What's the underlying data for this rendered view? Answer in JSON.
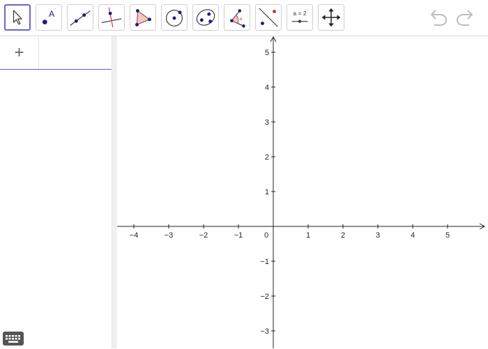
{
  "toolbar": {
    "tools": [
      {
        "icon": "move-arrow-icon",
        "active": true
      },
      {
        "icon": "point-icon",
        "label": "A"
      },
      {
        "icon": "line-icon"
      },
      {
        "icon": "perpendicular-line-icon"
      },
      {
        "icon": "polygon-icon"
      },
      {
        "icon": "circle-center-point-icon"
      },
      {
        "icon": "conic-ellipse-icon"
      },
      {
        "icon": "angle-icon",
        "label": "α"
      },
      {
        "icon": "reflect-about-line-icon"
      },
      {
        "icon": "slider-icon",
        "label": "a = 2"
      },
      {
        "icon": "move-graphics-view-icon"
      }
    ],
    "undo_icon": "undo-icon",
    "redo_icon": "redo-icon"
  },
  "algebra": {
    "add_label": "+"
  },
  "graphics": {
    "x_ticks": [
      "−4",
      "−3",
      "−2",
      "−1",
      "0",
      "1",
      "2",
      "3",
      "4",
      "5"
    ],
    "y_ticks": [
      "5",
      "4",
      "3",
      "2",
      "1",
      "−1",
      "−2",
      "−3"
    ],
    "x_range": [
      -4.5,
      6.1
    ],
    "y_range": [
      -3.5,
      5.5
    ]
  },
  "colors": {
    "active_border": "#6666cc",
    "point_fill": "#1a1a8c",
    "accent_red": "#cc3333",
    "polygon_fill": "#f4c7c3"
  }
}
